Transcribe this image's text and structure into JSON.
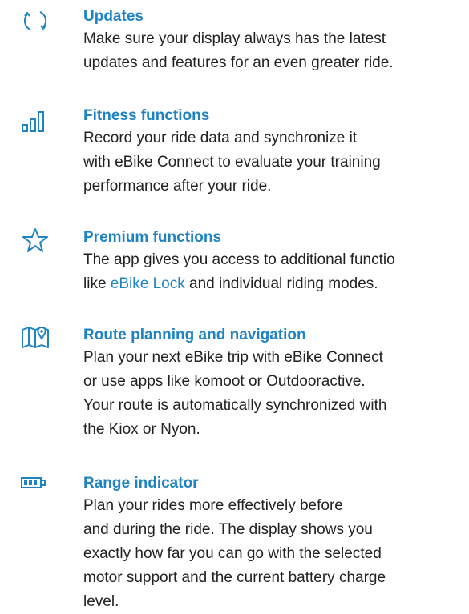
{
  "colors": {
    "accent": "#1f83c2",
    "text": "#222222",
    "background": "#ffffff"
  },
  "features": [
    {
      "icon": "refresh-icon",
      "title": "Updates",
      "lines": [
        "Make sure your display always has the latest",
        "updates and features for an even greater ride."
      ]
    },
    {
      "icon": "bar-chart-icon",
      "title": "Fitness functions",
      "lines": [
        "Record your ride data and synchronize it",
        "with eBike Connect to evaluate your training",
        "performance after your ride."
      ]
    },
    {
      "icon": "star-icon",
      "title": "Premium functions",
      "lines": [
        "The app gives you access to additional functio",
        "like ",
        "eBike Lock",
        " and individual riding modes."
      ]
    },
    {
      "icon": "map-pin-icon",
      "title": "Route planning and navigation",
      "lines": [
        "Plan your next eBike trip with eBike Connect",
        "or use apps like komoot or Outdooractive.",
        "Your route is automatically synchronized with",
        "the Kiox or Nyon."
      ]
    },
    {
      "icon": "battery-icon",
      "title": "Range indicator",
      "lines": [
        "Plan your rides more effectively before",
        "and during the ride. The display shows you",
        "exactly how far you can go with the selected",
        "motor support and the current battery charge",
        "level."
      ]
    }
  ]
}
